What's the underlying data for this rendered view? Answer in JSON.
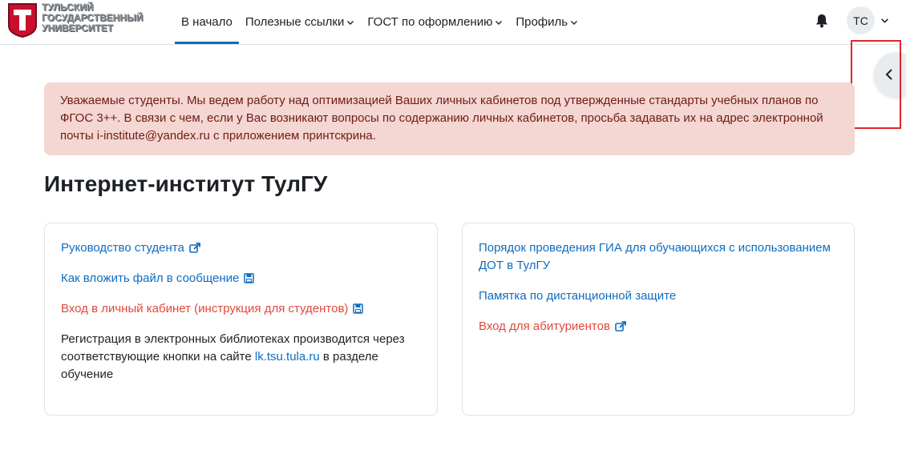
{
  "logo": {
    "lines": [
      "Тульский",
      "государственный",
      "университет"
    ],
    "letter": "Т"
  },
  "nav": {
    "items": [
      {
        "label": "В начало",
        "active": true,
        "dropdown": false
      },
      {
        "label": "Полезные ссылки",
        "active": false,
        "dropdown": true
      },
      {
        "label": "ГОСТ по оформлению",
        "active": false,
        "dropdown": true
      },
      {
        "label": "Профиль",
        "active": false,
        "dropdown": true
      }
    ]
  },
  "user": {
    "initials": "ТС"
  },
  "icons": {
    "notifications": "bell-icon",
    "drawer": "chevron-left-icon",
    "external": "external-link-icon",
    "save": "floppy-disk-icon"
  },
  "alert": {
    "text": "Уважаемые студенты. Мы ведем работу над оптимизацией Ваших личных кабинетов под утвержденные стандарты учебных планов по ФГОС 3++. В связи с чем, если у Вас возникают вопросы по содержанию личных кабинетов, просьба задавать их на адрес электронной почты i-institute@yandex.ru с приложением принтскрина."
  },
  "page": {
    "title": "Интернет-институт ТулГУ"
  },
  "left_card": {
    "link1": "Руководство студента",
    "link2": "Как вложить файл в сообщение",
    "link3": "Вход в личный кабинет (инструкция для студентов)",
    "text_before": "Регистрация в электронных библиотеках производится через соответствующие кнопки на сайте ",
    "text_link": "lk.tsu.tula.ru",
    "text_after": " в разделе обучение"
  },
  "right_card": {
    "link1": "Порядок проведения ГИА для обучающихся с использованием ДОТ в ТулГУ",
    "link2": "Памятка по дистанционной защите",
    "link3": "Вход для абитуриентов"
  },
  "colors": {
    "link": "#0f6cbf",
    "link_red": "#e0483d",
    "alert_bg": "#f4d6d2",
    "alert_text": "#6e1d14",
    "logo_red": "#c8102e",
    "highlight": "#e3242b"
  }
}
